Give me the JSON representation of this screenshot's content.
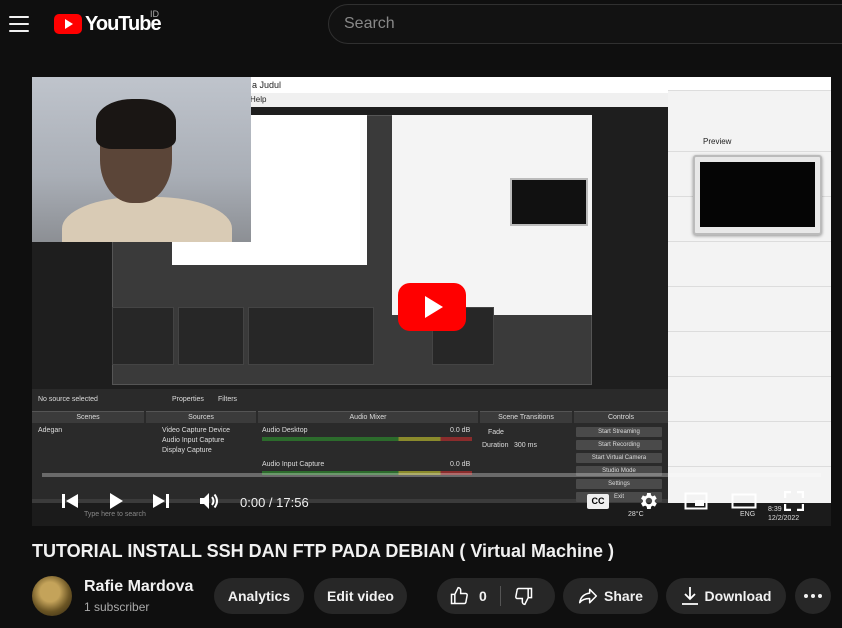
{
  "header": {
    "logo_text": "YouTube",
    "country_code": "ID",
    "search_placeholder": "Search"
  },
  "player": {
    "current_time": "0:00",
    "duration": "17:56",
    "time_display": "0:00 / 17:56",
    "progress": 0,
    "cc_label": "CC",
    "screen": {
      "window_title": "a Judul",
      "menu": "Help",
      "preview_label": "Preview",
      "docks": {
        "no_source": "No source selected",
        "properties": "Properties",
        "filters": "Filters",
        "scenes_header": "Scenes",
        "sources_header": "Sources",
        "mixer_header": "Audio Mixer",
        "transitions_header": "Scene Transitions",
        "controls_header": "Controls",
        "scene_item": "Adegan",
        "sources": [
          "Video Capture Device",
          "Audio Input Capture",
          "Display Capture"
        ],
        "mixer_desktop": "Audio Desktop",
        "mixer_input": "Audio Input Capture",
        "db_value": "0.0 dB",
        "transition_value": "Fade",
        "duration_label": "Duration",
        "duration_value": "300 ms",
        "controls": [
          "Start Streaming",
          "Start Recording",
          "Start Virtual Camera",
          "Studio Mode",
          "Settings",
          "Exit"
        ]
      },
      "taskbar": {
        "search": "Type here to search",
        "temp": "28°C",
        "time": "8:39",
        "date": "12/2/2022",
        "lang": "ENG"
      }
    }
  },
  "video": {
    "title": "TUTORIAL INSTALL SSH DAN FTP PADA DEBIAN ( Virtual Machine )",
    "channel_name": "Rafie Mardova",
    "subscribers": "1 subscriber",
    "like_count": "0"
  },
  "actions": {
    "analytics": "Analytics",
    "edit_video": "Edit video",
    "share": "Share",
    "download": "Download"
  },
  "colors": {
    "accent": "#ff0000",
    "background": "#0f0f0f",
    "pill": "#272727"
  }
}
